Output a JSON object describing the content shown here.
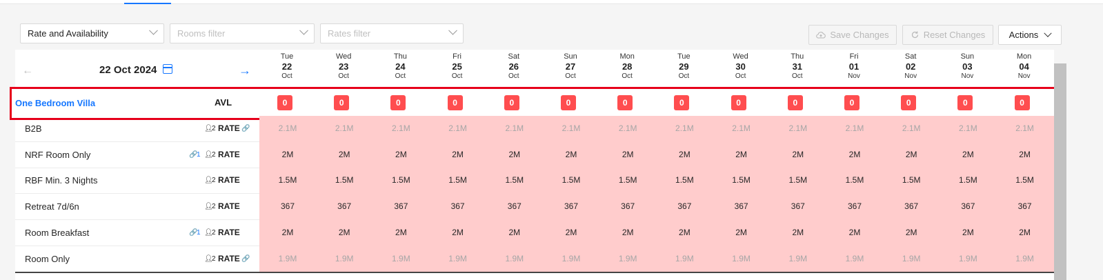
{
  "toolbar": {
    "view_select": "Rate and Availability",
    "rooms_filter_placeholder": "Rooms filter",
    "rates_filter_placeholder": "Rates filter",
    "save_label": "Save Changes",
    "reset_label": "Reset Changes",
    "actions_label": "Actions"
  },
  "calendar": {
    "current_date": "22 Oct 2024",
    "days": [
      {
        "dow": "Tue",
        "date": "22",
        "month": "Oct"
      },
      {
        "dow": "Wed",
        "date": "23",
        "month": "Oct"
      },
      {
        "dow": "Thu",
        "date": "24",
        "month": "Oct"
      },
      {
        "dow": "Fri",
        "date": "25",
        "month": "Oct"
      },
      {
        "dow": "Sat",
        "date": "26",
        "month": "Oct"
      },
      {
        "dow": "Sun",
        "date": "27",
        "month": "Oct"
      },
      {
        "dow": "Mon",
        "date": "28",
        "month": "Oct"
      },
      {
        "dow": "Tue",
        "date": "29",
        "month": "Oct"
      },
      {
        "dow": "Wed",
        "date": "30",
        "month": "Oct"
      },
      {
        "dow": "Thu",
        "date": "31",
        "month": "Oct"
      },
      {
        "dow": "Fri",
        "date": "01",
        "month": "Nov"
      },
      {
        "dow": "Sat",
        "date": "02",
        "month": "Nov"
      },
      {
        "dow": "Sun",
        "date": "03",
        "month": "Nov"
      },
      {
        "dow": "Mon",
        "date": "04",
        "month": "Nov"
      }
    ]
  },
  "room": {
    "name": "One Bedroom Villa",
    "availability_label": "AVL",
    "availability": [
      "0",
      "0",
      "0",
      "0",
      "0",
      "0",
      "0",
      "0",
      "0",
      "0",
      "0",
      "0",
      "0",
      "0"
    ]
  },
  "rate_plans": [
    {
      "name": "B2B",
      "occupancy": "2",
      "linked": "",
      "label": "RATE",
      "values": [
        "2.1M",
        "2.1M",
        "2.1M",
        "2.1M",
        "2.1M",
        "2.1M",
        "2.1M",
        "2.1M",
        "2.1M",
        "2.1M",
        "2.1M",
        "2.1M",
        "2.1M",
        "2.1M"
      ],
      "dim": true
    },
    {
      "name": "NRF Room Only",
      "occupancy": "2",
      "linked": "1",
      "label": "RATE",
      "values": [
        "2M",
        "2M",
        "2M",
        "2M",
        "2M",
        "2M",
        "2M",
        "2M",
        "2M",
        "2M",
        "2M",
        "2M",
        "2M",
        "2M"
      ],
      "dim": false
    },
    {
      "name": "RBF Min. 3 Nights",
      "occupancy": "2",
      "linked": "",
      "label": "RATE",
      "values": [
        "1.5M",
        "1.5M",
        "1.5M",
        "1.5M",
        "1.5M",
        "1.5M",
        "1.5M",
        "1.5M",
        "1.5M",
        "1.5M",
        "1.5M",
        "1.5M",
        "1.5M",
        "1.5M"
      ],
      "dim": false
    },
    {
      "name": "Retreat 7d/6n",
      "occupancy": "2",
      "linked": "",
      "label": "RATE",
      "values": [
        "367",
        "367",
        "367",
        "367",
        "367",
        "367",
        "367",
        "367",
        "367",
        "367",
        "367",
        "367",
        "367",
        "367"
      ],
      "dim": false
    },
    {
      "name": "Room Breakfast",
      "occupancy": "2",
      "linked": "1",
      "label": "RATE",
      "values": [
        "2M",
        "2M",
        "2M",
        "2M",
        "2M",
        "2M",
        "2M",
        "2M",
        "2M",
        "2M",
        "2M",
        "2M",
        "2M",
        "2M"
      ],
      "dim": false
    },
    {
      "name": "Room Only",
      "occupancy": "2",
      "linked": "",
      "label": "RATE",
      "values": [
        "1.9M",
        "1.9M",
        "1.9M",
        "1.9M",
        "1.9M",
        "1.9M",
        "1.9M",
        "1.9M",
        "1.9M",
        "1.9M",
        "1.9M",
        "1.9M",
        "1.9M",
        "1.9M"
      ],
      "dim": true
    }
  ],
  "colors": {
    "accent": "#1677ff",
    "badge": "#ff4d4f",
    "cell_bg": "#ffcccc",
    "highlight_border": "#e6001a"
  }
}
